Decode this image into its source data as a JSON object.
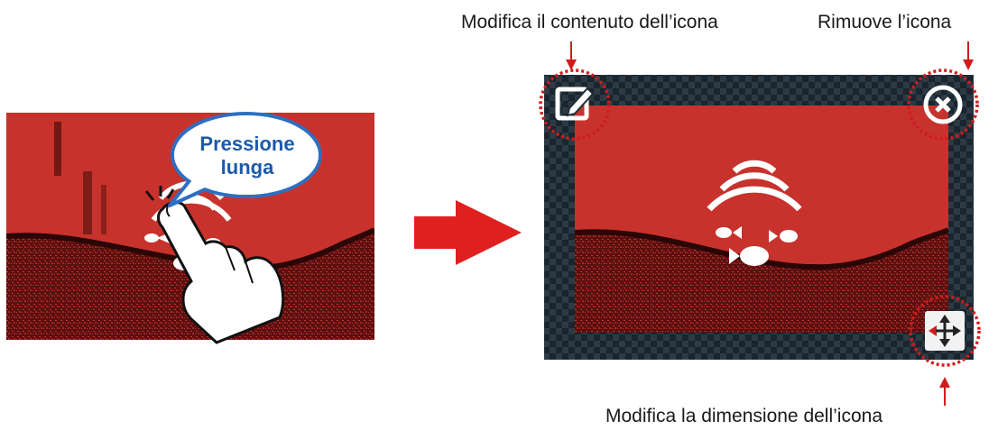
{
  "left_panel": {
    "bubble_text": "Pressione\nlunga",
    "gesture": "long-press",
    "icon": "sonar-fish-icon"
  },
  "arrow": {
    "color": "#e0201f"
  },
  "right_panel": {
    "edit_icon": "edit-icon",
    "remove_icon": "close-circle-icon",
    "resize_icon": "move-arrows-icon",
    "widget_icon": "sonar-fish-icon"
  },
  "callouts": {
    "edit": "Modifica il contenuto dell’icona",
    "remove": "Rimuove l’icona",
    "resize": "Modifica la dimensione dell’icona"
  },
  "colors": {
    "sonar_red": "#c8322c",
    "frame_dark": "#1f2c35",
    "bubble_text": "#1d5aa8",
    "highlight_ring": "#d01c1c"
  }
}
